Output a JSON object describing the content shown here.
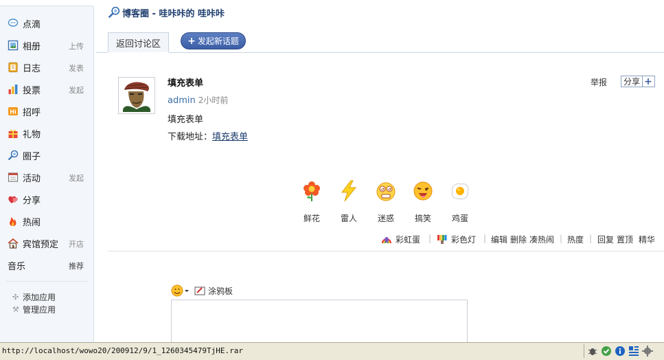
{
  "header": {
    "title": "博客圈 - 哇咔咔的 哇咔咔"
  },
  "sidebar": {
    "items": [
      {
        "label": "点滴",
        "action": "",
        "icon": "speech-bubble-icon"
      },
      {
        "label": "相册",
        "action": "上传",
        "icon": "photo-icon"
      },
      {
        "label": "日志",
        "action": "发表",
        "icon": "notebook-icon"
      },
      {
        "label": "投票",
        "action": "发起",
        "icon": "bar-chart-icon"
      },
      {
        "label": "招呼",
        "action": "",
        "icon": "hi-icon"
      },
      {
        "label": "礼物",
        "action": "",
        "icon": "gift-icon"
      },
      {
        "label": "圈子",
        "action": "",
        "icon": "group-icon"
      },
      {
        "label": "活动",
        "action": "发起",
        "icon": "calendar-icon"
      },
      {
        "label": "分享",
        "action": "",
        "icon": "heart-icon"
      },
      {
        "label": "热闹",
        "action": "",
        "icon": "flame-icon"
      },
      {
        "label": "宾馆预定",
        "action": "开店",
        "icon": "house-icon"
      },
      {
        "label": "音乐",
        "action": "推荐",
        "icon": ""
      }
    ],
    "add_app": "添加应用",
    "manage_app": "管理应用"
  },
  "tabs": {
    "back": "返回讨论区",
    "new_topic": "发起新话题"
  },
  "post": {
    "title": "填充表单",
    "author": "admin",
    "time": "2小时前",
    "body": "填充表单",
    "download_label": "下载地址：",
    "download_link": "填充表单",
    "report": "举报",
    "share": "分享"
  },
  "reactions": [
    {
      "label": "鲜花",
      "icon": "flower-icon"
    },
    {
      "label": "雷人",
      "icon": "lightning-icon"
    },
    {
      "label": "迷惑",
      "icon": "dizzy-face-icon"
    },
    {
      "label": "搞笑",
      "icon": "laughing-face-icon"
    },
    {
      "label": "鸡蛋",
      "icon": "egg-icon"
    }
  ],
  "actions": {
    "rainbow_egg": "彩虹蛋",
    "color_light": "彩色灯",
    "edit": "编辑",
    "delete": "删除",
    "bump": "凑热闹",
    "heat": "热度",
    "reply": "回复",
    "pin": "置顶",
    "feature": "精华"
  },
  "editor": {
    "doodle": "涂鸦板"
  },
  "statusbar": {
    "url": "http://localhost/wowo20/200912/9/1_1260345479TjHE.rar"
  },
  "colors": {
    "link": "#3b6ea8",
    "title": "#1f3e6e",
    "button": "#3b5ea6",
    "sidebar_bg": "#f3f6fa"
  }
}
